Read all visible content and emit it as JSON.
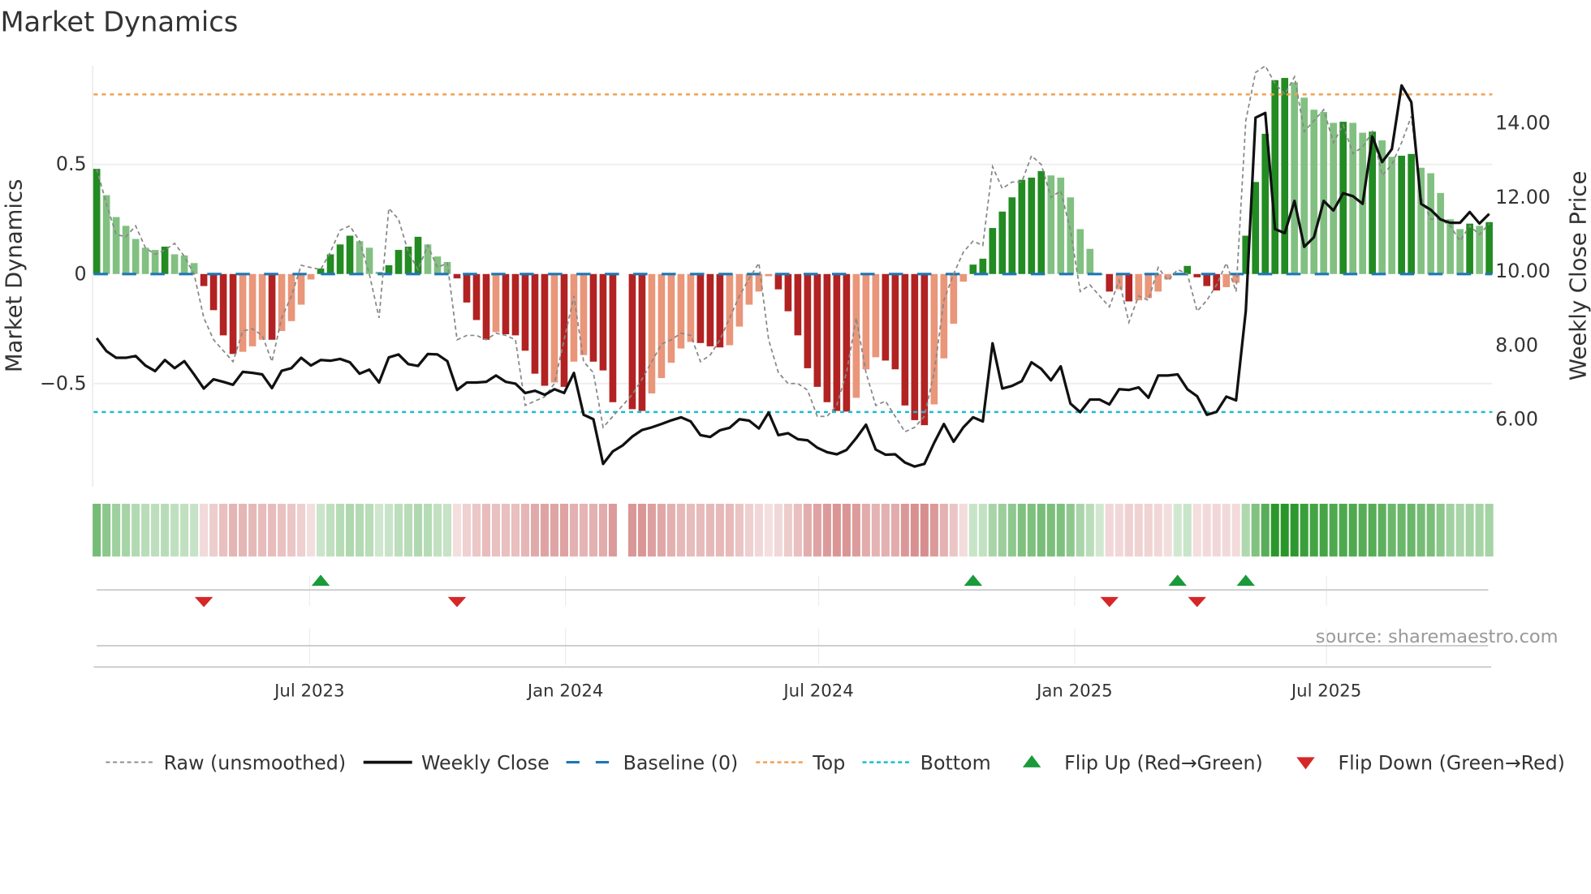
{
  "chart_data": {
    "type": "bar",
    "title": "Market Dynamics",
    "ylabel_left": "Market Dynamics",
    "ylabel_right": "Weekly Close Price",
    "source": "source: sharemaestro.com",
    "start_date": "2023-01-29",
    "frequency": "weekly",
    "ylim_left": [
      -0.97,
      0.95
    ],
    "ylim_right": [
      4.16,
      15.53
    ],
    "yticks_left": [
      {
        "value": 0.5,
        "label": "0.5"
      },
      {
        "value": 0,
        "label": "0"
      },
      {
        "value": -0.5,
        "label": "−0.5"
      }
    ],
    "yticks_right": [
      {
        "value": 14,
        "label": "14.00"
      },
      {
        "value": 12,
        "label": "12.00"
      },
      {
        "value": 10,
        "label": "10.00"
      },
      {
        "value": 8,
        "label": "8.00"
      },
      {
        "value": 6,
        "label": "6.00"
      }
    ],
    "xticks": [
      {
        "date": "2023-07-01",
        "label": "Jul 2023"
      },
      {
        "date": "2024-01-01",
        "label": "Jan 2024"
      },
      {
        "date": "2024-07-01",
        "label": "Jul 2024"
      },
      {
        "date": "2025-01-01",
        "label": "Jan 2025"
      },
      {
        "date": "2025-07-01",
        "label": "Jul 2025"
      }
    ],
    "top_level": 0.82,
    "bottom_level": -0.63,
    "baseline": 0,
    "colors": {
      "up_strong": "#228b22",
      "up_weak": "#82c082",
      "down_strong": "#b22222",
      "down_weak": "#e9967a",
      "baseline": "#1f77b4",
      "top": "#f0a050",
      "bottom": "#17becf",
      "close": "#111111",
      "raw": "#888888",
      "flip_up": "#1a9a3a",
      "flip_down": "#d62728"
    },
    "smoothed": [
      0.48,
      0.36,
      0.26,
      0.22,
      0.16,
      0.12,
      0.11,
      0.125,
      0.09,
      0.085,
      0.05,
      -0.055,
      -0.165,
      -0.28,
      -0.365,
      -0.355,
      -0.33,
      -0.3,
      -0.3,
      -0.26,
      -0.215,
      -0.14,
      -0.025,
      0.025,
      0.09,
      0.135,
      0.175,
      0.15,
      0.12,
      0.01,
      0.04,
      0.11,
      0.125,
      0.17,
      0.135,
      0.08,
      0.055,
      -0.02,
      -0.13,
      -0.21,
      -0.3,
      -0.265,
      -0.275,
      -0.28,
      -0.35,
      -0.455,
      -0.51,
      -0.495,
      -0.515,
      -0.4,
      -0.37,
      -0.4,
      -0.44,
      -0.585,
      null,
      -0.617,
      -0.625,
      -0.545,
      -0.475,
      -0.405,
      -0.34,
      -0.31,
      -0.315,
      -0.33,
      -0.335,
      -0.325,
      -0.24,
      -0.14,
      -0.08,
      -0.01,
      -0.07,
      -0.17,
      -0.28,
      -0.43,
      -0.515,
      -0.585,
      -0.625,
      -0.628,
      -0.565,
      -0.435,
      -0.38,
      -0.395,
      -0.435,
      -0.6,
      -0.667,
      -0.69,
      -0.595,
      -0.385,
      -0.227,
      -0.035,
      0.043,
      0.07,
      0.21,
      0.285,
      0.35,
      0.43,
      0.44,
      0.47,
      0.45,
      0.44,
      0.35,
      0.205,
      0.115,
      0,
      -0.08,
      -0.07,
      -0.125,
      -0.12,
      -0.11,
      -0.08,
      -0.025,
      0,
      0.037,
      -0.015,
      -0.055,
      -0.075,
      -0.06,
      -0.04,
      0.175,
      0.42,
      0.64,
      0.885,
      0.895,
      0.875,
      0.805,
      0.75,
      0.74,
      0.69,
      0.695,
      0.69,
      0.645,
      0.65,
      0.61,
      0.535,
      0.54,
      0.548,
      0.485,
      0.46,
      0.37,
      0.25,
      0.205,
      0.23,
      0.22,
      0.237
    ],
    "raw": [
      0.48,
      0.32,
      0.18,
      0.17,
      0.22,
      0.12,
      0.09,
      0.11,
      0.14,
      0.08,
      0.0,
      -0.2,
      -0.3,
      -0.35,
      -0.4,
      -0.26,
      -0.25,
      -0.28,
      -0.4,
      -0.2,
      -0.1,
      0.04,
      0.03,
      0.02,
      0.1,
      0.2,
      0.22,
      0.15,
      0.0,
      -0.2,
      0.3,
      0.25,
      0.1,
      0.02,
      0.13,
      0.03,
      0.05,
      -0.3,
      -0.28,
      -0.28,
      -0.3,
      -0.27,
      -0.28,
      -0.3,
      -0.6,
      -0.58,
      -0.56,
      -0.5,
      -0.3,
      -0.1,
      -0.4,
      -0.45,
      -0.7,
      -0.65,
      -0.6,
      -0.55,
      -0.48,
      -0.4,
      -0.32,
      -0.3,
      -0.27,
      -0.28,
      -0.4,
      -0.37,
      -0.3,
      -0.2,
      -0.1,
      -0.02,
      0.05,
      -0.3,
      -0.45,
      -0.5,
      -0.5,
      -0.53,
      -0.65,
      -0.65,
      -0.6,
      -0.45,
      -0.2,
      -0.45,
      -0.6,
      -0.58,
      -0.65,
      -0.72,
      -0.7,
      -0.65,
      -0.45,
      -0.12,
      0.0,
      0.1,
      0.15,
      0.13,
      0.49,
      0.39,
      0.42,
      0.42,
      0.54,
      0.5,
      0.35,
      0.38,
      0.2,
      -0.08,
      -0.05,
      -0.1,
      -0.15,
      -0.03,
      -0.22,
      -0.1,
      -0.12,
      0.03,
      -0.03,
      0.02,
      0.0,
      -0.17,
      -0.12,
      -0.05,
      0.05,
      -0.08,
      0.7,
      0.92,
      0.95,
      0.87,
      0.82,
      0.9,
      0.65,
      0.7,
      0.75,
      0.6,
      0.68,
      0.55,
      0.58,
      0.65,
      0.45,
      0.5,
      0.6,
      0.72,
      0.35,
      0.25,
      0.25,
      0.22,
      0.15,
      0.22,
      0.18,
      0.23
    ],
    "close": [
      8.17,
      7.82,
      7.64,
      7.64,
      7.69,
      7.43,
      7.28,
      7.58,
      7.36,
      7.55,
      7.19,
      6.81,
      7.06,
      6.99,
      6.91,
      7.26,
      7.23,
      7.19,
      6.82,
      7.29,
      7.36,
      7.64,
      7.43,
      7.58,
      7.56,
      7.61,
      7.52,
      7.21,
      7.32,
      6.97,
      7.65,
      7.73,
      7.47,
      7.42,
      7.74,
      7.73,
      7.55,
      6.77,
      6.97,
      6.97,
      6.99,
      7.16,
      6.99,
      6.94,
      6.69,
      6.75,
      6.64,
      6.79,
      6.69,
      7.23,
      6.1,
      5.98,
      4.77,
      5.11,
      5.27,
      5.51,
      5.69,
      5.76,
      5.85,
      5.95,
      6.03,
      5.92,
      5.55,
      5.5,
      5.68,
      5.75,
      5.98,
      5.94,
      5.73,
      6.16,
      5.55,
      5.6,
      5.44,
      5.41,
      5.21,
      5.09,
      5.03,
      5.15,
      5.47,
      5.83,
      5.16,
      5.02,
      5.03,
      4.81,
      4.7,
      4.77,
      5.34,
      5.85,
      5.37,
      5.76,
      6.03,
      5.92,
      8.03,
      6.81,
      6.88,
      7.01,
      7.52,
      7.34,
      7.03,
      7.41,
      6.4,
      6.17,
      6.51,
      6.51,
      6.38,
      6.79,
      6.77,
      6.84,
      6.56,
      7.16,
      7.16,
      7.19,
      6.79,
      6.6,
      6.1,
      6.18,
      6.59,
      6.49,
      8.91,
      14.13,
      14.26,
      11.12,
      11.01,
      11.88,
      10.64,
      10.9,
      11.88,
      11.62,
      12.09,
      12.01,
      11.8,
      13.62,
      12.93,
      13.28,
      15.0,
      14.55,
      11.8,
      11.64,
      11.38,
      11.29,
      11.29,
      11.58,
      11.27,
      11.53
    ],
    "flips_up": [
      "2023-07-09",
      "2024-10-20",
      "2025-03-16",
      "2025-05-04"
    ],
    "flips_down": [
      "2023-04-16",
      "2023-10-15",
      "2025-01-26",
      "2025-03-30"
    ],
    "legend": {
      "placement": "bottom",
      "items": [
        {
          "key": "raw",
          "label": "Raw (unsmoothed)"
        },
        {
          "key": "close",
          "label": "Weekly Close"
        },
        {
          "key": "baseline",
          "label": "Baseline (0)"
        },
        {
          "key": "top",
          "label": "Top"
        },
        {
          "key": "bottom",
          "label": "Bottom"
        },
        {
          "key": "flip_up",
          "label": "Flip Up (Red→Green)"
        },
        {
          "key": "flip_down",
          "label": "Flip Down (Green→Red)"
        }
      ]
    }
  }
}
